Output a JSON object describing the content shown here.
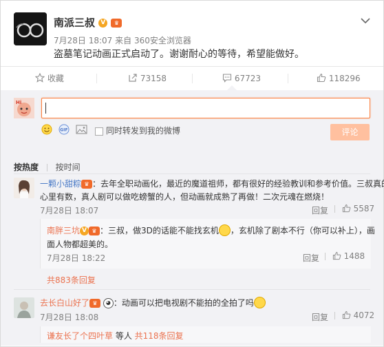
{
  "post": {
    "author": "南派三叔",
    "time": "7月28日 18:07",
    "source_prefix": "来自",
    "source": "360安全浏览器",
    "content": "盗墓笔记动画正式启动了。谢谢耐心的等待，希望能做好。"
  },
  "actions": {
    "favorite_label": "收藏",
    "repost_count": "73158",
    "comment_count": "67723",
    "like_count": "118296"
  },
  "composer": {
    "placeholder": "",
    "also_repost_label": "同时转发到我的微博",
    "submit_label": "评论"
  },
  "sort": {
    "by_hot": "按热度",
    "by_time": "按时间"
  },
  "comments": [
    {
      "user": "一颗小甜粽",
      "text_line1": "：去年全职动画化，最近的魔道祖师，都有很好的经验教训和参考价值。三叔真的",
      "text_line2": "心里有数，真人剧可以做吃螃蟹的人，但动画就成熟了再做！二次元魂在燃烧！",
      "time": "7月28日 18:07",
      "reply_label": "回复",
      "likes": "5587",
      "reply": {
        "user": "南胖三坑",
        "text_a": "：三叔，做3D的话能不能找玄机",
        "text_b": "，玄机除了剧本不行（你可以补上），画",
        "text_line2": "面人物都超美的。",
        "time": "7月28日 18:22",
        "reply_label": "回复",
        "likes": "1488"
      },
      "more_replies": "共883条回复"
    },
    {
      "user": "去长白山好了",
      "text": "：动画可以把电视剧不能拍的全拍了吗",
      "time": "7月28日 18:08",
      "reply_label": "回复",
      "likes": "4072",
      "reply_preview_user": "谦友长了个四叶草",
      "reply_preview_mid": " 等人 ",
      "reply_preview_count": "共118条回复"
    }
  ]
}
